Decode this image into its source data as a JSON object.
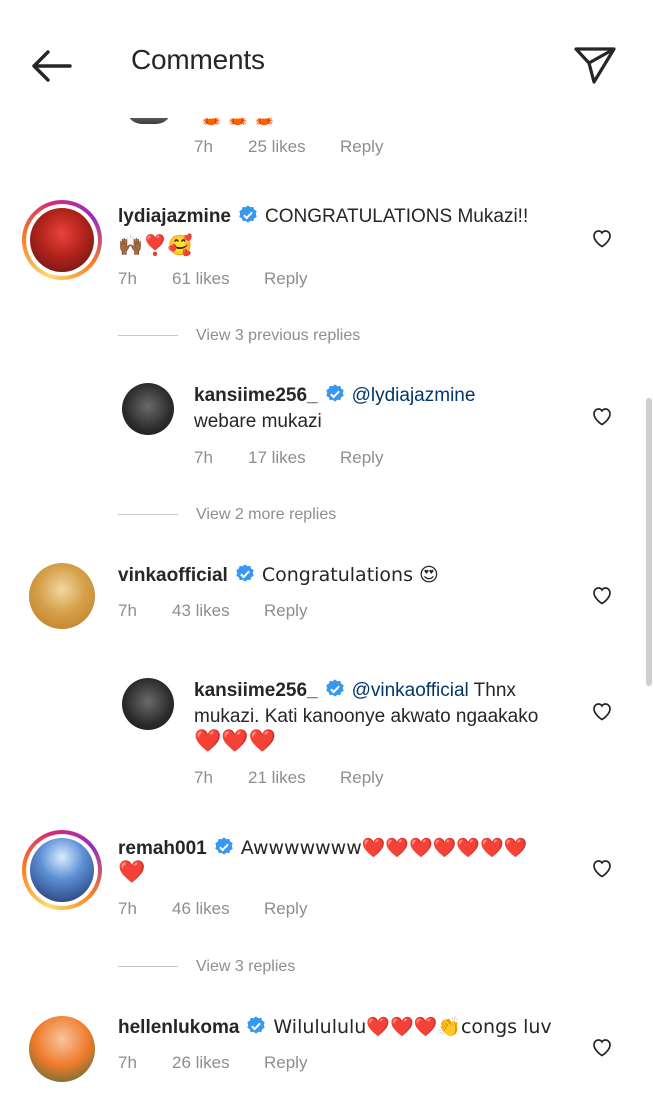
{
  "header": {
    "title": "Comments"
  },
  "top_partial": {
    "emoji": "🦀🦀🦀",
    "time": "7h",
    "likes": "25 likes",
    "reply": "Reply"
  },
  "comments": [
    {
      "username": "lydiajazmine",
      "text": "CONGRATULATIONS Mukazi!!",
      "text2": "🙌🏾❣️🥰",
      "time": "7h",
      "likes": "61 likes",
      "reply": "Reply",
      "view_replies": "View 3 previous replies",
      "replies": [
        {
          "username": "kansiime256_",
          "mention": "@lydiajazmine",
          "text": "",
          "text2": "webare mukazi",
          "time": "7h",
          "likes": "17 likes",
          "reply": "Reply"
        }
      ],
      "view_more": "View 2 more replies"
    },
    {
      "username": "vinkaofficial",
      "text": "Congratulations 😍",
      "time": "7h",
      "likes": "43 likes",
      "reply": "Reply",
      "replies": [
        {
          "username": "kansiime256_",
          "mention": "@vinkaofficial",
          "text": " Thnx",
          "text2": "mukazi. Kati kanoonye akwato ngaakako",
          "text3": "❤️❤️❤️",
          "time": "7h",
          "likes": "21 likes",
          "reply": "Reply"
        }
      ]
    },
    {
      "username": "remah001",
      "text": "Awwwwwww❤️❤️❤️❤️❤️❤️❤️",
      "text2": "❤️",
      "time": "7h",
      "likes": "46 likes",
      "reply": "Reply",
      "view_replies": "View 3 replies"
    },
    {
      "username": "hellenlukoma",
      "text": "Wilulululu❤️❤️❤️👏congs luv",
      "time": "7h",
      "likes": "26 likes",
      "reply": "Reply"
    }
  ],
  "colors": {
    "verified": "#3897f0",
    "meta": "#8e8e8e",
    "mention": "#00376b"
  },
  "icons": [
    "back-arrow-icon",
    "send-icon",
    "verified-icon",
    "heart-outline-icon"
  ]
}
